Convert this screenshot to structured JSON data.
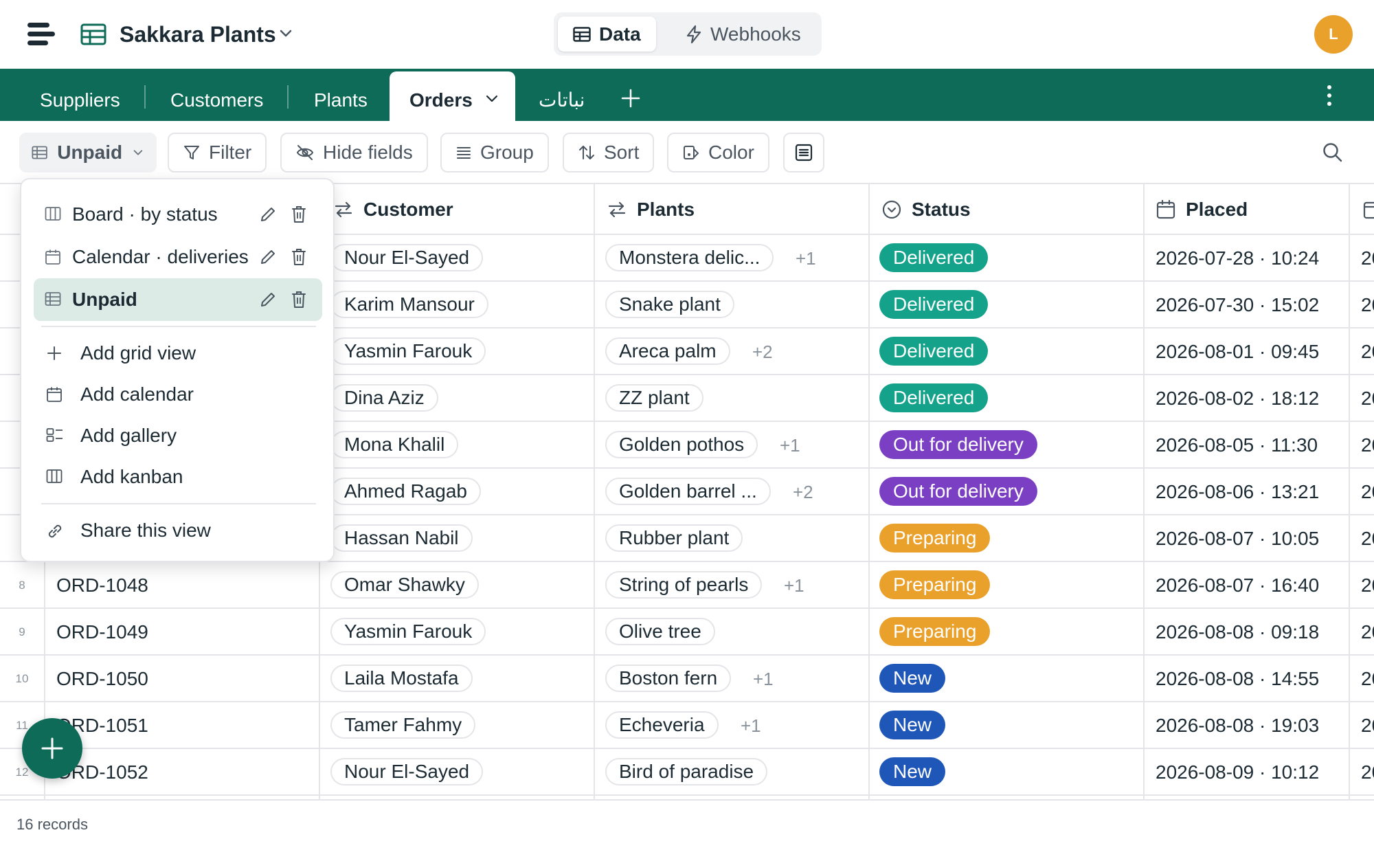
{
  "app": {
    "base_name": "Sakkara Plants",
    "modes": [
      {
        "label": "Data"
      },
      {
        "label": "Webhooks"
      }
    ],
    "user_initial": "L"
  },
  "tabs": [
    {
      "label": "Suppliers"
    },
    {
      "label": "Customers"
    },
    {
      "label": "Plants"
    },
    {
      "label": "Orders"
    },
    {
      "label": "نباتات"
    }
  ],
  "toolbar": {
    "view_name": "Unpaid",
    "filter": "Filter",
    "hide_fields": "Hide fields",
    "group": "Group",
    "sort": "Sort",
    "color": "Color"
  },
  "view_menu": {
    "views": [
      {
        "label": "Board · by status",
        "icon": "kanban-icon"
      },
      {
        "label": "Calendar · deliveries",
        "icon": "calendar-icon"
      },
      {
        "label": "Unpaid",
        "icon": "grid-icon"
      }
    ],
    "actions": [
      {
        "label": "Add grid view",
        "icon": "plus-icon"
      },
      {
        "label": "Add calendar",
        "icon": "calendar-icon"
      },
      {
        "label": "Add gallery",
        "icon": "gallery-icon"
      },
      {
        "label": "Add kanban",
        "icon": "kanban-icon"
      }
    ],
    "share": "Share this view"
  },
  "columns": {
    "customer": "Customer",
    "plants": "Plants",
    "status": "Status",
    "placed": "Placed"
  },
  "status_colors": {
    "Delivered": "#14a38a",
    "Out for delivery": "#7b3fc4",
    "Preparing": "#eaa12b",
    "New": "#1f57b8"
  },
  "rows": [
    {
      "num": "",
      "id": "",
      "customer": "Nour El-Sayed",
      "plant": "Monstera delic...",
      "more": "+1",
      "status": "Delivered",
      "placed": "2026-07-28 · 10:24",
      "cut": "20"
    },
    {
      "num": "",
      "id": "",
      "customer": "Karim Mansour",
      "plant": "Snake plant",
      "more": "",
      "status": "Delivered",
      "placed": "2026-07-30 · 15:02",
      "cut": "20"
    },
    {
      "num": "",
      "id": "",
      "customer": "Yasmin Farouk",
      "plant": "Areca palm",
      "more": "+2",
      "status": "Delivered",
      "placed": "2026-08-01 · 09:45",
      "cut": "20"
    },
    {
      "num": "",
      "id": "",
      "customer": "Dina Aziz",
      "plant": "ZZ plant",
      "more": "",
      "status": "Delivered",
      "placed": "2026-08-02 · 18:12",
      "cut": "20"
    },
    {
      "num": "",
      "id": "",
      "customer": "Mona Khalil",
      "plant": "Golden pothos",
      "more": "+1",
      "status": "Out for delivery",
      "placed": "2026-08-05 · 11:30",
      "cut": "20"
    },
    {
      "num": "",
      "id": "",
      "customer": "Ahmed Ragab",
      "plant": "Golden barrel ...",
      "more": "+2",
      "status": "Out for delivery",
      "placed": "2026-08-06 · 13:21",
      "cut": "20"
    },
    {
      "num": "",
      "id": "",
      "customer": "Hassan Nabil",
      "plant": "Rubber plant",
      "more": "",
      "status": "Preparing",
      "placed": "2026-08-07 · 10:05",
      "cut": "20"
    },
    {
      "num": "8",
      "id": "ORD-1048",
      "customer": "Omar Shawky",
      "plant": "String of pearls",
      "more": "+1",
      "status": "Preparing",
      "placed": "2026-08-07 · 16:40",
      "cut": "20"
    },
    {
      "num": "9",
      "id": "ORD-1049",
      "customer": "Yasmin Farouk",
      "plant": "Olive tree",
      "more": "",
      "status": "Preparing",
      "placed": "2026-08-08 · 09:18",
      "cut": "20"
    },
    {
      "num": "10",
      "id": "ORD-1050",
      "customer": "Laila Mostafa",
      "plant": "Boston fern",
      "more": "+1",
      "status": "New",
      "placed": "2026-08-08 · 14:55",
      "cut": "20"
    },
    {
      "num": "11",
      "id": "ORD-1051",
      "customer": "Tamer Fahmy",
      "plant": "Echeveria",
      "more": "+1",
      "status": "New",
      "placed": "2026-08-08 · 19:03",
      "cut": "20"
    },
    {
      "num": "12",
      "id": "ORD-1052",
      "customer": "Nour El-Sayed",
      "plant": "Bird of paradise",
      "more": "",
      "status": "New",
      "placed": "2026-08-09 · 10:12",
      "cut": "20"
    }
  ],
  "footer": {
    "record_count": "16 records"
  }
}
